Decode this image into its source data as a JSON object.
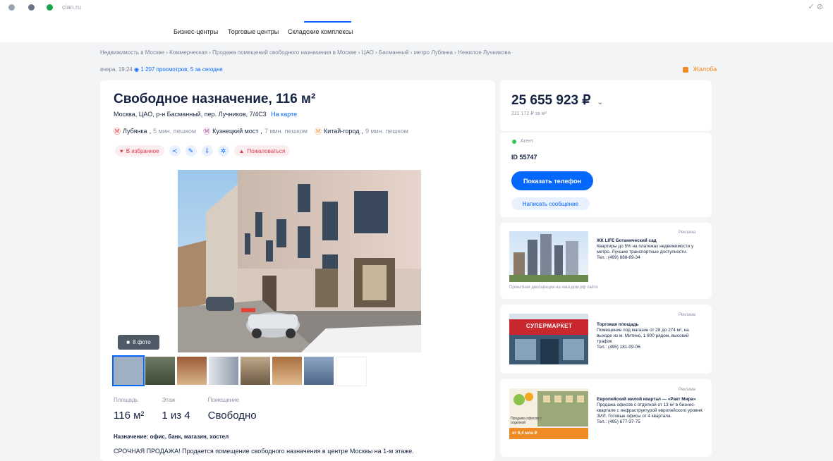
{
  "browser": {
    "url": "cian.ru",
    "right_controls": "✓ ⊘"
  },
  "nav": {
    "tabs": [
      {
        "label": "Бизнес-центры"
      },
      {
        "label": "Торговые центры"
      },
      {
        "label": "Складские комплексы"
      }
    ]
  },
  "breadcrumb": "Недвижимость в Москве  ›  Коммерческая  ›  Продажа помещений свободного назначения в Москве  ›  ЦАО  ›  Басманный  ›  метро Лубянка  ›  Нежилое Лучникова",
  "meta": {
    "updated": "вчера, 19:24",
    "views": "1 207 просмотров, 5 за сегодня"
  },
  "report_label": "Жалоба",
  "listing": {
    "title": "Свободное назначение, 116 м²",
    "address": "Москва, ЦАО, р-н Басманный, пер. Лучников, 7/4С3",
    "map_link": "На карте",
    "metro": [
      {
        "name": "Лубянка",
        "time": "5 мин. пешком",
        "color": "#e2222b"
      },
      {
        "name": "Кузнецкий мост",
        "time": "7 мин. пешком",
        "color": "#a23a8e"
      },
      {
        "name": "Китай-город",
        "time": "9 мин. пешком",
        "color": "#f08a24"
      }
    ],
    "actions": {
      "favorite": "В избранное",
      "report": "Пожаловаться"
    },
    "photo_count": "8 фото",
    "specs": [
      {
        "label": "Площадь",
        "value": "116 м²"
      },
      {
        "label": "Этаж",
        "value": "1 из 4"
      },
      {
        "label": "Помещение",
        "value": "Свободно"
      }
    ],
    "purpose": "Назначение: офис, банк, магазин, хостел",
    "description": "СРОЧНАЯ ПРОДАЖА! Продается помещение свободного назначения в центре Москвы на 1-м этаже."
  },
  "sidebar": {
    "price": "25 655 923 ₽",
    "price_per_m": "221 172 ₽ за м²",
    "online": "Агент",
    "agent_id": "ID 55747",
    "show_phone": "Показать телефон",
    "write_message": "Написать сообщение"
  },
  "ads": [
    {
      "tag": "Реклама",
      "title": "ЖК LIFE Ботанический сад",
      "text": "Квартиры до 5% на платежах недвижимости у метро. Лучшие транспортные доступности.",
      "phone": "Тел.: (499) 888-89-34",
      "footer": "Проектная декларация на наш.дом.рф сайте"
    },
    {
      "tag": "Реклама",
      "title": "Торговая площадь",
      "text": "Помещение под магазин от 28 до 274 м², на выходе из м. Митино, 1 800 рядом, высокий трафик",
      "phone": "Тел.: (495) 181-09-06",
      "sign": "СУПЕРМАРКЕТ"
    },
    {
      "tag": "Реклама",
      "title": "Европейский жилой квартал — «Ракт Мира»",
      "text": "Продажа офисов с отделкой от 13 м² в бизнес-квартале с инфраструктурой европейского уровня. ЗИЛ. Готовые офисы от 4 квартала.",
      "phone": "Тел.: (495) 677-37-75",
      "img_text": "Продажа офисов с отделкой",
      "img_price": "от 6,4 млн ₽"
    }
  ]
}
